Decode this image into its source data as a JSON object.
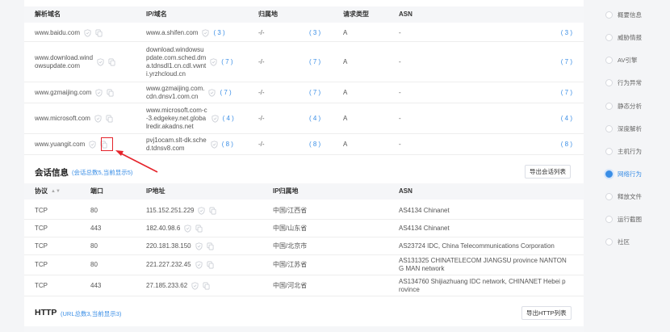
{
  "dns": {
    "headers": {
      "domain": "解析域名",
      "ip": "IP/域名",
      "location": "归属地",
      "req_type": "请求类型",
      "asn": "ASN"
    },
    "rows": [
      {
        "domain": "www.baidu.com",
        "ip": "www.a.shifen.com",
        "ip_count": "( 3 )",
        "location": "-/-",
        "loc_count": "( 3 )",
        "req_type": "A",
        "asn": "-",
        "asn_count": "( 3 )"
      },
      {
        "domain": "www.download.windowsupdate.com",
        "domain_lines": [
          "www.download.wind",
          "owsupdate.com"
        ],
        "ip_lines": [
          "download.windowsu",
          "pdate.com.sched.dm",
          "a.tdnsdl1.cn.cdl.vwnt",
          "i.yrzhcloud.cn"
        ],
        "ip_count": "( 7 )",
        "location": "-/-",
        "loc_count": "( 7 )",
        "req_type": "A",
        "asn": "-",
        "asn_count": "( 7 )"
      },
      {
        "domain": "www.gzmaijing.com",
        "ip_lines": [
          "www.gzmaijing.com.",
          "cdn.dnsv1.com.cn"
        ],
        "ip_count": "( 7 )",
        "location": "-/-",
        "loc_count": "( 7 )",
        "req_type": "A",
        "asn": "-",
        "asn_count": "( 7 )"
      },
      {
        "domain": "www.microsoft.com",
        "ip_lines": [
          "www.microsoft.com-c",
          "-3.edgekey.net.globa",
          "lredir.akadns.net"
        ],
        "ip_count": "( 4 )",
        "location": "-/-",
        "loc_count": "( 4 )",
        "req_type": "A",
        "asn": "-",
        "asn_count": "( 4 )"
      },
      {
        "domain": "www.yuangit.com",
        "ip_lines": [
          "pvj1ocam.slt-dk.sche",
          "d.tdnsv8.com"
        ],
        "ip_count": "( 8 )",
        "location": "-/-",
        "loc_count": "( 8 )",
        "req_type": "A",
        "asn": "-",
        "asn_count": "( 8 )"
      }
    ]
  },
  "session": {
    "title": "会话信息",
    "subtitle": "(会话总数5,当前显示5)",
    "export_label": "导出会话列表",
    "headers": {
      "protocol": "协议",
      "port": "端口",
      "ip": "IP地址",
      "location": "IP归属地",
      "asn": "ASN"
    },
    "rows": [
      {
        "protocol": "TCP",
        "port": "80",
        "ip": "115.152.251.229",
        "location": "中国/江西省",
        "asn_lines": [
          "AS4134 Chinanet"
        ]
      },
      {
        "protocol": "TCP",
        "port": "443",
        "ip": "182.40.98.6",
        "location": "中国/山东省",
        "asn_lines": [
          "AS4134 Chinanet"
        ]
      },
      {
        "protocol": "TCP",
        "port": "80",
        "ip": "220.181.38.150",
        "location": "中国/北京市",
        "asn_lines": [
          "AS23724 IDC, China Telecommunications Corporation"
        ]
      },
      {
        "protocol": "TCP",
        "port": "80",
        "ip": "221.227.232.45",
        "location": "中国/江苏省",
        "asn_lines": [
          "AS131325 CHINATELECOM JIANGSU province NANTON",
          "G MAN network"
        ]
      },
      {
        "protocol": "TCP",
        "port": "443",
        "ip": "27.185.233.62",
        "location": "中国/河北省",
        "asn_lines": [
          "AS134760 Shijiazhuang IDC network, CHINANET Hebei p",
          "rovince"
        ]
      }
    ]
  },
  "http": {
    "title": "HTTP",
    "subtitle": "(URL总数3,当前显示3)",
    "export_label": "导出HTTP列表"
  },
  "sidenav": {
    "items": [
      {
        "label": "概要信息",
        "active": false
      },
      {
        "label": "威胁情报",
        "active": false
      },
      {
        "label": "AV引擎",
        "active": false
      },
      {
        "label": "行为异常",
        "active": false
      },
      {
        "label": "静态分析",
        "active": false
      },
      {
        "label": "深度解析",
        "active": false
      },
      {
        "label": "主机行为",
        "active": false
      },
      {
        "label": "网络行为",
        "active": true
      },
      {
        "label": "释放文件",
        "active": false
      },
      {
        "label": "运行截图",
        "active": false
      },
      {
        "label": "社区",
        "active": false
      }
    ]
  },
  "colors": {
    "accent": "#3a8ee6",
    "annotation": "#e5242b"
  },
  "icons": {
    "shield": "shield-icon",
    "copy": "copy-icon",
    "sort": "sort-icon"
  }
}
